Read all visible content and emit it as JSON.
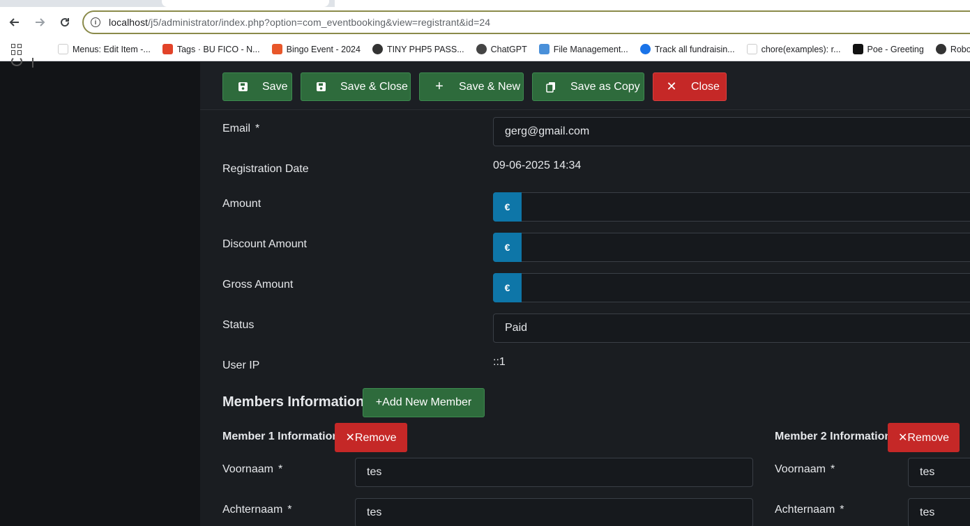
{
  "browser": {
    "url_host": "localhost",
    "url_path": "/j5/administrator/index.php?option=com_eventbooking&view=registrant&id=24",
    "bookmarks": [
      {
        "label": "Menus: Edit Item -...",
        "icon": "joomla-icon",
        "color": "#ffffff"
      },
      {
        "label": "Tags · BU FICO - N...",
        "icon": "gitlab-icon",
        "color": "#e24329"
      },
      {
        "label": "Bingo Event - 2024",
        "icon": "calendar-icon",
        "color": "#e8572a"
      },
      {
        "label": "TINY PHP5 PASS...",
        "icon": "globe-icon",
        "color": "#333333"
      },
      {
        "label": "ChatGPT",
        "icon": "chatgpt-icon",
        "color": "#444444"
      },
      {
        "label": "File Management...",
        "icon": "file-tree-icon",
        "color": "#4a90d9"
      },
      {
        "label": "Track all fundraisin...",
        "icon": "g-icon",
        "color": "#1a73e8"
      },
      {
        "label": "chore(examples): r...",
        "icon": "github-icon",
        "color": "#ffffff"
      },
      {
        "label": "Poe - Greeting",
        "icon": "poe-icon",
        "color": "#111111"
      },
      {
        "label": "Robo",
        "icon": "globe-icon",
        "color": "#333333"
      }
    ]
  },
  "toolbar": {
    "save": "Save",
    "save_close": "Save & Close",
    "save_new": "Save & New",
    "save_copy": "Save as Copy",
    "close": "Close"
  },
  "form": {
    "email_label": "Email",
    "email_value": "gerg@gmail.com",
    "reg_date_label": "Registration Date",
    "reg_date_value": "09-06-2025 14:34",
    "amount_label": "Amount",
    "discount_label": "Discount Amount",
    "gross_label": "Gross Amount",
    "currency": "€",
    "status_label": "Status",
    "status_value": "Paid",
    "ip_label": "User IP",
    "ip_value": "::1",
    "required_mark": "*"
  },
  "members": {
    "title": "Members Information",
    "add_button": "+Add New Member",
    "remove_button": "✕Remove",
    "list": [
      {
        "title": "Member 1 Information",
        "first_name_label": "Voornaam",
        "first_name": "tes",
        "last_name_label": "Achternaam",
        "last_name": "tes"
      },
      {
        "title": "Member 2 Information",
        "first_name_label": "Voornaam",
        "first_name": "tes",
        "last_name_label": "Achternaam",
        "last_name": "tes"
      }
    ]
  },
  "colors": {
    "green": "#2e6b3c",
    "red": "#c52827",
    "currency_blue": "#0e76a8"
  }
}
